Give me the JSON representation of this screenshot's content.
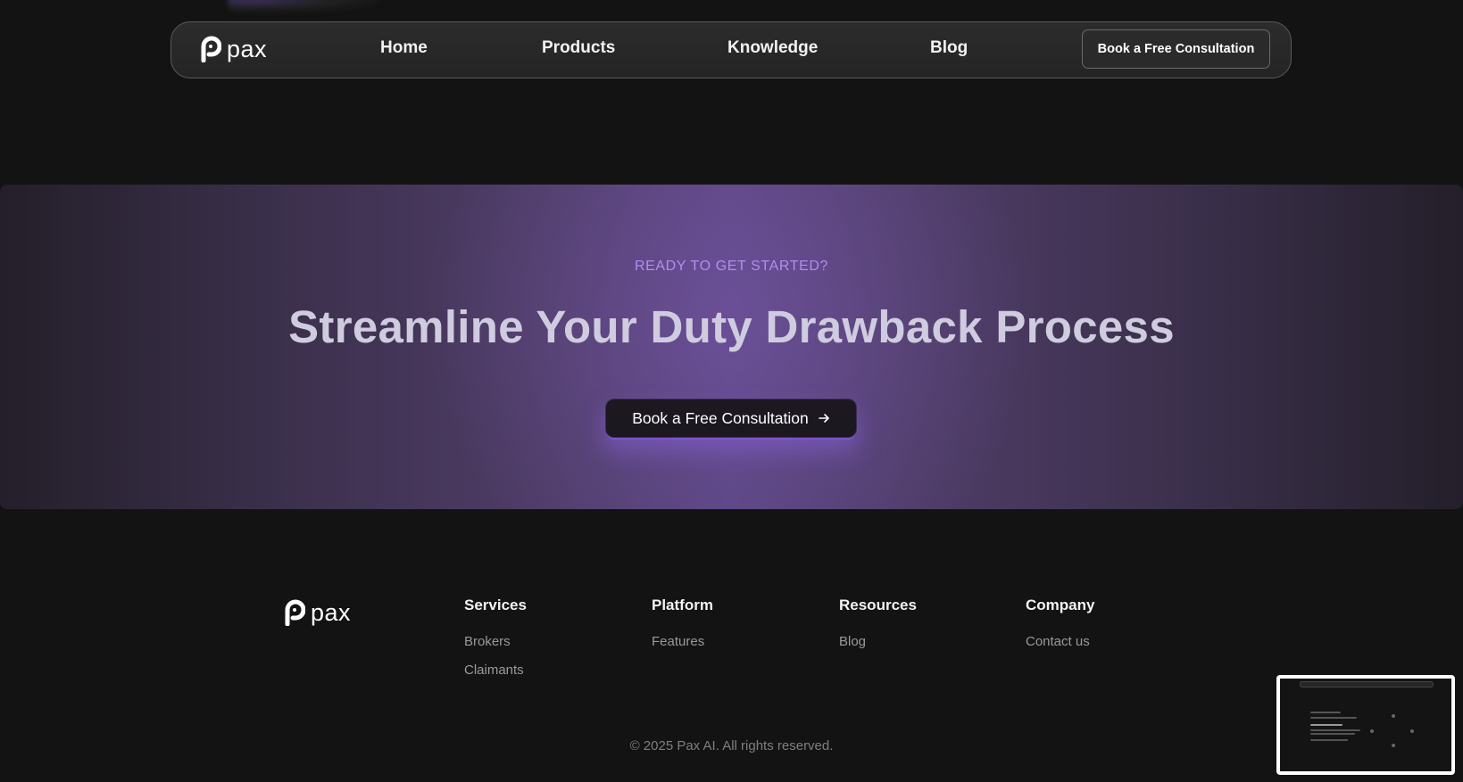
{
  "nav": {
    "logo_text": "pax",
    "links": [
      "Home",
      "Products",
      "Knowledge",
      "Blog"
    ],
    "cta_label": "Book a Free Consultation"
  },
  "cta_band": {
    "eyebrow": "READY TO GET STARTED?",
    "headline": "Streamline Your Duty Drawback Process",
    "button_label": "Book a Free Consultation",
    "button_icon": "arrow-right-icon"
  },
  "footer": {
    "logo_text": "pax",
    "columns": [
      {
        "title": "Services",
        "links": [
          "Brokers",
          "Claimants"
        ]
      },
      {
        "title": "Platform",
        "links": [
          "Features"
        ]
      },
      {
        "title": "Resources",
        "links": [
          "Blog"
        ]
      },
      {
        "title": "Company",
        "links": [
          "Contact us"
        ]
      }
    ],
    "copyright": "© 2025 Pax AI. All rights reserved."
  },
  "colors": {
    "background": "#131313",
    "accent_purple": "#b48cf0",
    "band_center": "#5a4580"
  }
}
